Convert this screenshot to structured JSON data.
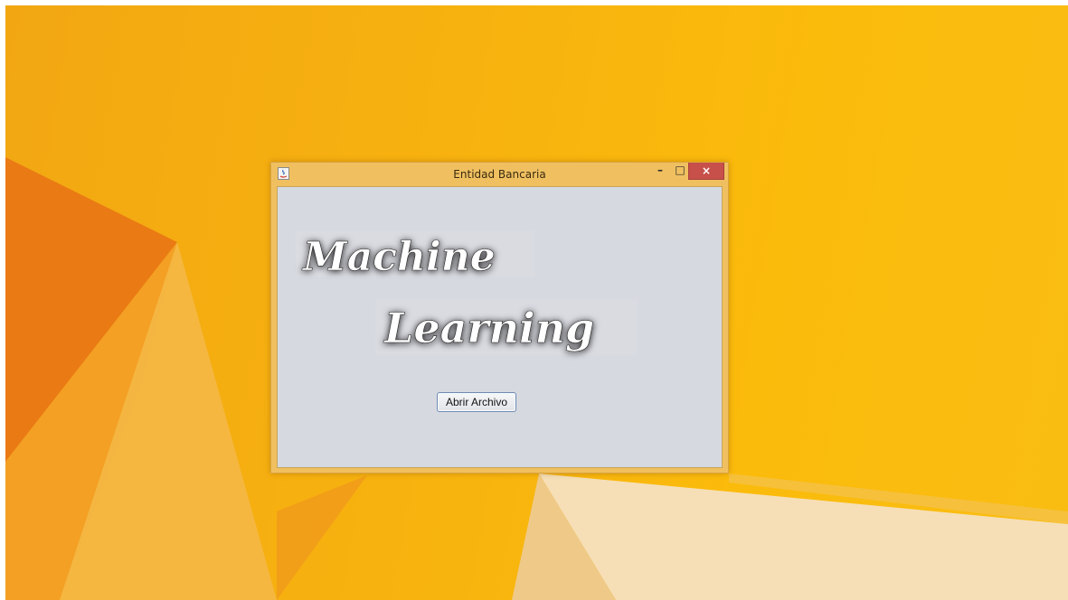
{
  "window": {
    "title": "Entidad Bancaria",
    "controls": {
      "minimize": "–",
      "maximize": "□",
      "close": "×"
    }
  },
  "content": {
    "logo_line1": "Machine",
    "logo_line2": "Learning",
    "open_button_label": "Abrir Archivo"
  },
  "icons": {
    "app": "java-app-icon",
    "minimize": "minimize-icon",
    "maximize": "maximize-icon",
    "close": "close-icon"
  },
  "colors": {
    "desktop": "#f7b20f",
    "close_button": "#c7504a",
    "client_area": "#d6d9e0"
  }
}
